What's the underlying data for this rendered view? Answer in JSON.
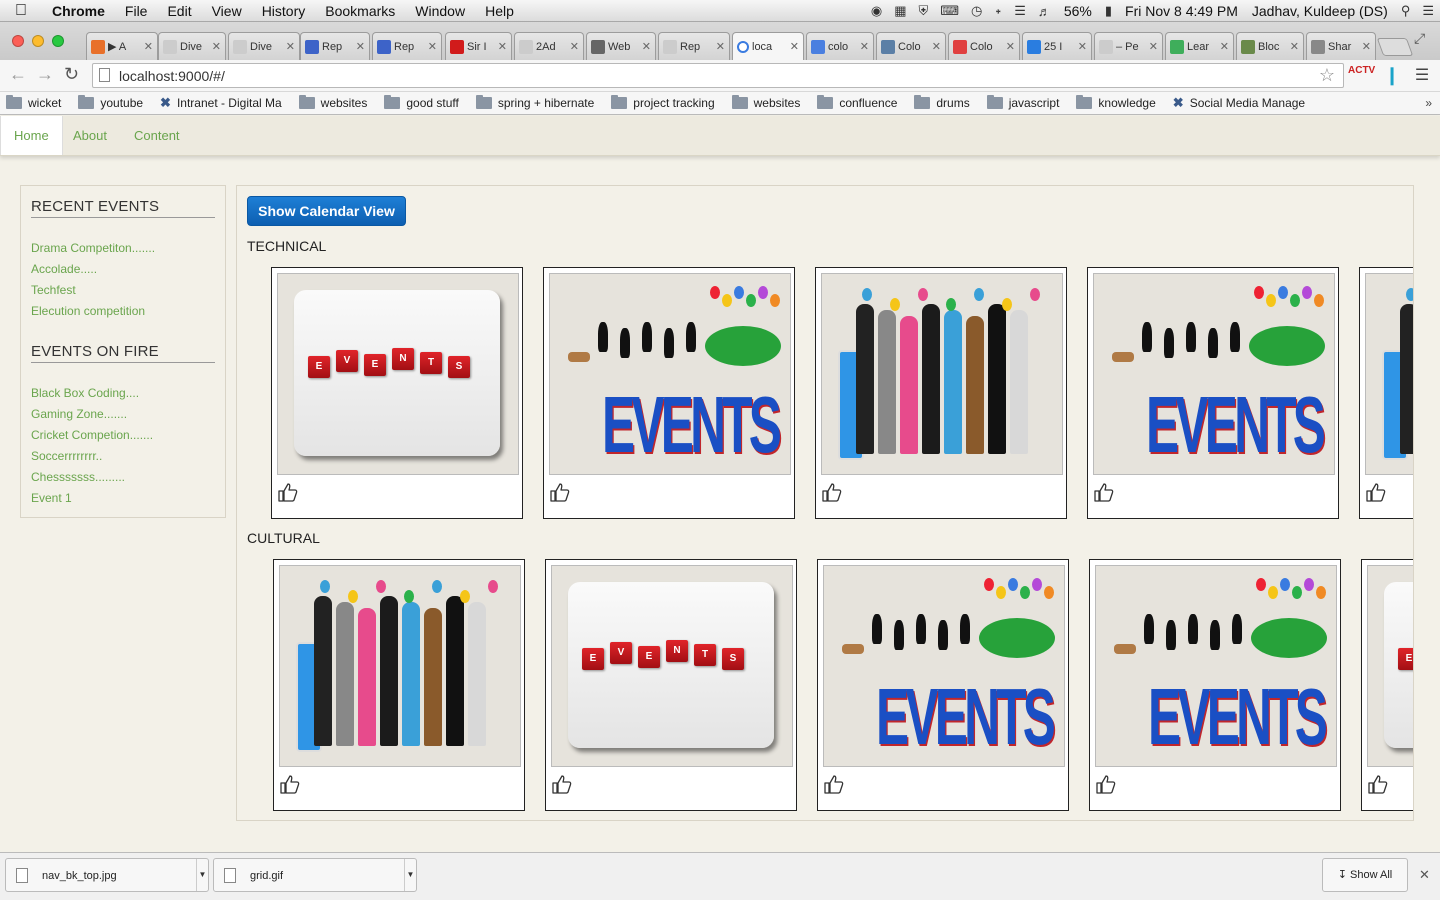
{
  "menubar": {
    "apple": "",
    "app": "Chrome",
    "menus": [
      "File",
      "Edit",
      "View",
      "History",
      "Bookmarks",
      "Window",
      "Help"
    ],
    "battery": "56%",
    "clock": "Fri Nov 8  4:49 PM",
    "user": "Jadhav, Kuldeep (DS)"
  },
  "tabs": [
    {
      "title": "▶ A",
      "fav": "#e8702a"
    },
    {
      "title": "Dive",
      "fav": "#cccccc"
    },
    {
      "title": "Dive",
      "fav": "#cccccc"
    },
    {
      "title": "Rep",
      "fav": "#3d63c8"
    },
    {
      "title": "Rep",
      "fav": "#3d63c8"
    },
    {
      "title": "Sir I",
      "fav": "#d11b1b"
    },
    {
      "title": "2Ad",
      "fav": "#cccccc"
    },
    {
      "title": "Web",
      "fav": "#666666"
    },
    {
      "title": "Rep",
      "fav": "#cccccc"
    },
    {
      "title": "loca",
      "fav": "#ffffff"
    },
    {
      "title": "colo",
      "fav": "#4a7fe0"
    },
    {
      "title": "Colo",
      "fav": "#5b7fa6"
    },
    {
      "title": "Colo",
      "fav": "#e04040"
    },
    {
      "title": "25 I",
      "fav": "#2a7de0"
    },
    {
      "title": "– Pe",
      "fav": "#cccccc"
    },
    {
      "title": "Lear",
      "fav": "#3fae5b"
    },
    {
      "title": "Bloc",
      "fav": "#6a8a4a"
    },
    {
      "title": "Shar",
      "fav": "#888888"
    }
  ],
  "toolbar": {
    "url": "localhost:9000/#/"
  },
  "bookmarks": [
    {
      "label": "wicket",
      "type": "folder"
    },
    {
      "label": "youtube",
      "type": "folder"
    },
    {
      "label": "Intranet - Digital Ma",
      "type": "x"
    },
    {
      "label": "websites",
      "type": "folder"
    },
    {
      "label": "good stuff",
      "type": "folder"
    },
    {
      "label": "spring + hibernate",
      "type": "folder"
    },
    {
      "label": "project tracking",
      "type": "folder"
    },
    {
      "label": "websites",
      "type": "folder"
    },
    {
      "label": "confluence",
      "type": "folder"
    },
    {
      "label": "drums",
      "type": "folder"
    },
    {
      "label": "javascript",
      "type": "folder"
    },
    {
      "label": "knowledge",
      "type": "folder"
    },
    {
      "label": "Social Media Manage",
      "type": "x"
    }
  ],
  "bookmarks_more": "»",
  "nav": {
    "home": "Home",
    "about": "About",
    "content": "Content"
  },
  "sidebar": {
    "recent_heading": "RECENT EVENTS",
    "recent": [
      "Drama Competiton.......",
      "Accolade.....",
      "Techfest",
      "Elecution competition"
    ],
    "fire_heading": "EVENTS ON FIRE",
    "fire": [
      "Black Box Coding....",
      "Gaming Zone.......",
      "Cricket Competion.......",
      "Soccerrrrrrrr..",
      "Chesssssss.........",
      "Event 1"
    ]
  },
  "main": {
    "calendar_button": "Show Calendar View",
    "technical_label": "TECHNICAL",
    "cultural_label": "CULTURAL",
    "technical_cards": [
      "blocks",
      "parade",
      "crowd",
      "parade",
      "crowd"
    ],
    "cultural_cards": [
      "crowd",
      "blocks",
      "parade",
      "parade",
      "blocks"
    ],
    "events_word": "EVENTS",
    "dice_letters": [
      "E",
      "V",
      "E",
      "N",
      "T",
      "S"
    ]
  },
  "downloads": {
    "items": [
      "nav_bk_top.jpg",
      "grid.gif"
    ],
    "show_all": "Show All"
  }
}
